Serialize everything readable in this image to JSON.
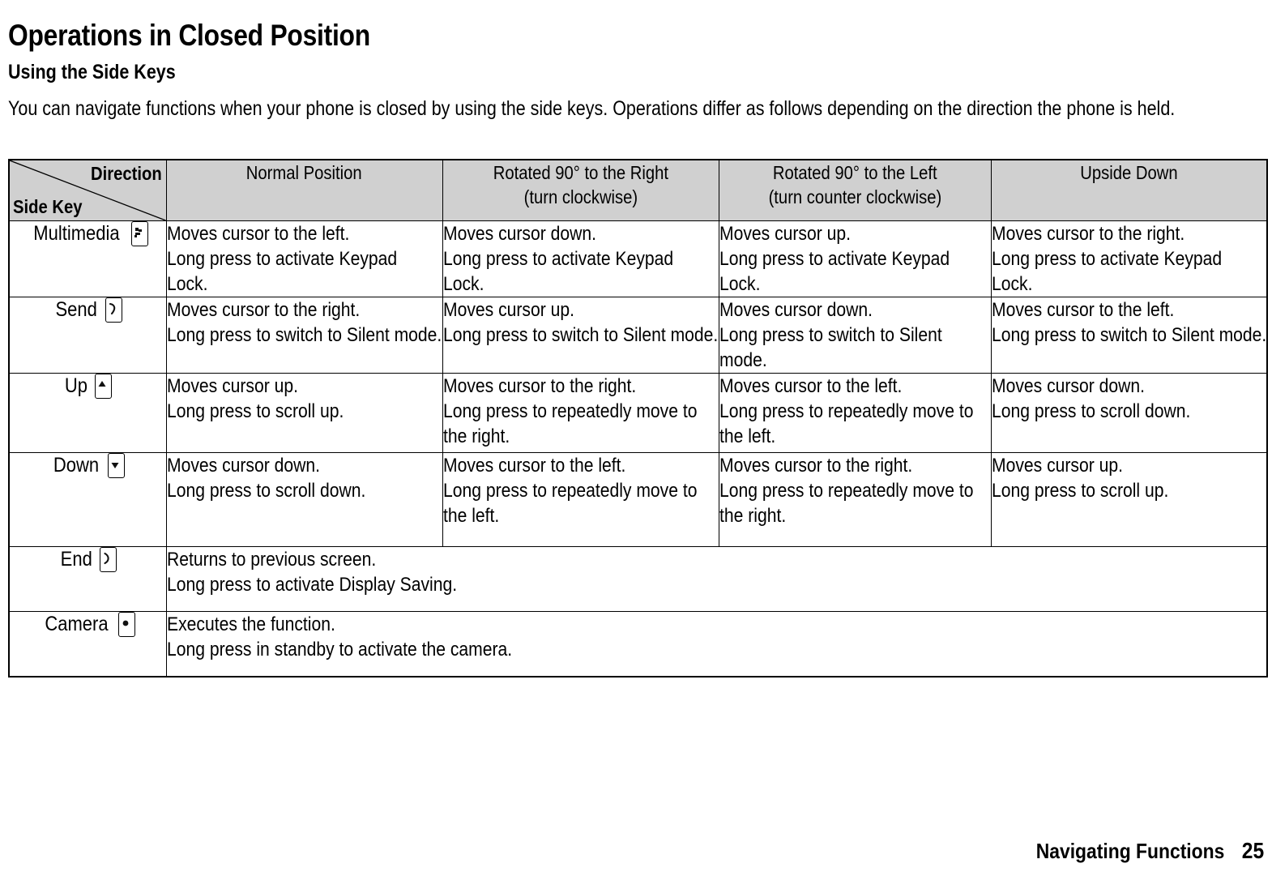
{
  "document": {
    "title": "Operations in Closed Position",
    "subtitle": "Using the Side Keys",
    "intro": "You can navigate functions when your phone is closed by using the side keys. Operations differ as follows depending on the direction the phone is held."
  },
  "table": {
    "corner": {
      "direction_label": "Direction",
      "side_key_label": "Side Key"
    },
    "header_bg": "#d0d0d0",
    "columns": [
      {
        "line1": "Normal Position",
        "line2": ""
      },
      {
        "line1": "Rotated 90° to the Right",
        "line2": "(turn clockwise)"
      },
      {
        "line1": "Rotated 90° to the Left",
        "line2": "(turn counter clockwise)"
      },
      {
        "line1": "Upside Down",
        "line2": ""
      }
    ],
    "rows": [
      {
        "key_label": "Multimedia",
        "key_icon": "multimedia-key-icon",
        "spans_all": false,
        "cells": [
          [
            "Moves cursor to the left.",
            "Long press to activate Keypad Lock."
          ],
          [
            "Moves cursor down.",
            "Long press to activate Keypad Lock."
          ],
          [
            "Moves cursor up.",
            "Long press to activate Keypad Lock."
          ],
          [
            "Moves cursor to the right.",
            "Long press to activate Keypad Lock."
          ]
        ]
      },
      {
        "key_label": "Send",
        "key_icon": "send-key-icon",
        "spans_all": false,
        "cells": [
          [
            "Moves cursor to the right.",
            "Long press to switch to Silent mode."
          ],
          [
            "Moves cursor up.",
            "Long press to switch to Silent mode."
          ],
          [
            "Moves cursor down.",
            "Long press to switch to Silent mode."
          ],
          [
            "Moves cursor to the left.",
            "Long press to switch to Silent mode."
          ]
        ]
      },
      {
        "key_label": "Up",
        "key_icon": "up-key-icon",
        "spans_all": false,
        "cells": [
          [
            "Moves cursor up.",
            "Long press to scroll up."
          ],
          [
            "Moves cursor to the right.",
            "Long press to repeatedly move to the right."
          ],
          [
            "Moves cursor to the left.",
            "Long press to repeatedly move to the left."
          ],
          [
            "Moves cursor down.",
            "Long press to scroll down."
          ]
        ]
      },
      {
        "key_label": "Down",
        "key_icon": "down-key-icon",
        "spans_all": false,
        "cells": [
          [
            "Moves cursor down.",
            "Long press to scroll down."
          ],
          [
            "Moves cursor to the left.",
            "Long press to repeatedly move to the left."
          ],
          [
            "Moves cursor to the right.",
            "Long press to repeatedly move to the right."
          ],
          [
            "Moves cursor up.",
            "Long press to scroll up."
          ]
        ]
      },
      {
        "key_label": "End",
        "key_icon": "end-key-icon",
        "spans_all": true,
        "cells": [
          [
            "Returns to previous screen.",
            "Long press to activate Display Saving."
          ]
        ]
      },
      {
        "key_label": "Camera",
        "key_icon": "camera-key-icon",
        "spans_all": true,
        "cells": [
          [
            "Executes the function.",
            "Long press in standby to activate the camera."
          ]
        ]
      }
    ]
  },
  "footer": {
    "section": "Navigating Functions",
    "page": "25"
  }
}
